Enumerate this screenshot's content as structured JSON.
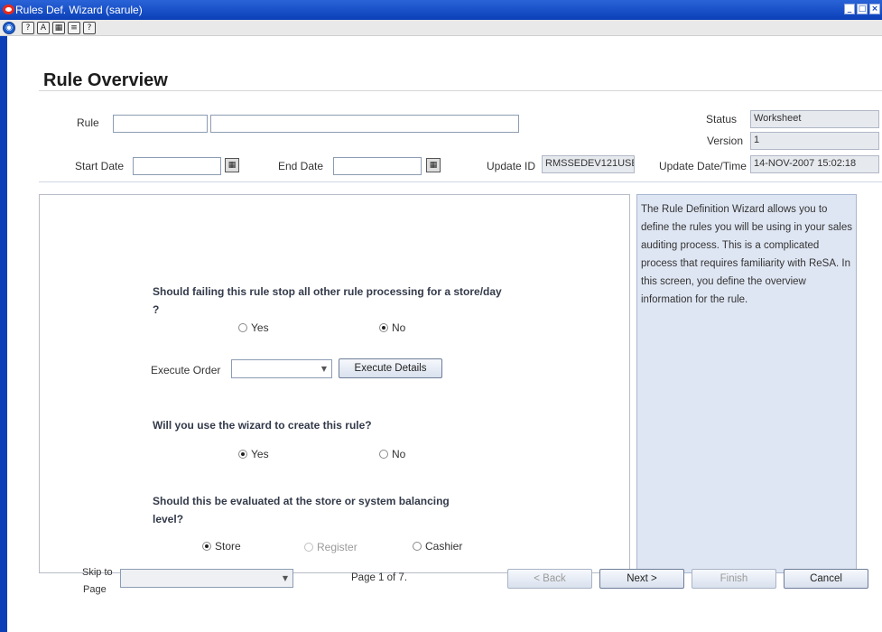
{
  "window": {
    "title": "Rules Def. Wizard  (sarule)",
    "controls": [
      "minimize",
      "restore",
      "close"
    ]
  },
  "toolbar": {
    "icons": [
      "globe-icon",
      "help-icon",
      "spellcheck-icon",
      "calendar-icon",
      "notes-icon",
      "about-icon"
    ]
  },
  "page": {
    "title": "Rule Overview"
  },
  "header": {
    "rule_label": "Rule",
    "rule_id_value": "",
    "rule_desc_value": "",
    "status_label": "Status",
    "status_value": "Worksheet",
    "version_label": "Version",
    "version_value": "1",
    "start_date_label": "Start Date",
    "start_date_value": "",
    "end_date_label": "End Date",
    "end_date_value": "",
    "update_id_label": "Update ID",
    "update_id_value": "RMSSEDEV121USEI",
    "update_datetime_label": "Update Date/Time",
    "update_datetime_value": "14-NOV-2007 15:02:18"
  },
  "form": {
    "q1": "Should failing this rule stop all other rule processing for a store/day ?",
    "q1_options": [
      {
        "label": "Yes",
        "selected": false
      },
      {
        "label": "No",
        "selected": true
      }
    ],
    "execute_order_label": "Execute Order",
    "execute_order_value": "",
    "execute_details_button": "Execute Details",
    "q2": "Will you use the wizard to create this rule?",
    "q2_options": [
      {
        "label": "Yes",
        "selected": true
      },
      {
        "label": "No",
        "selected": false
      }
    ],
    "q3": "Should this be evaluated at the store or system balancing level?",
    "q3_options": [
      {
        "label": "Store",
        "selected": true,
        "enabled": true
      },
      {
        "label": "Register",
        "selected": false,
        "enabled": false
      },
      {
        "label": "Cashier",
        "selected": false,
        "enabled": true
      }
    ]
  },
  "help_text": "The Rule Definition Wizard allows you to define the rules you will be using in your sales auditing process.  This is a complicated process that requires familiarity with ReSA.  In this screen, you define the overview information for the rule.",
  "footer": {
    "skip_label_line1": "Skip to",
    "skip_label_line2": "Page",
    "skip_value": "",
    "page_indicator": "Page 1 of 7.",
    "back_button": "< Back",
    "next_button": "Next >",
    "finish_button": "Finish",
    "cancel_button": "Cancel"
  },
  "colors": {
    "titlebar": "#0a3fb8",
    "panel_bg": "#dfe6f3",
    "readonly_bg": "#e6e9ee"
  }
}
